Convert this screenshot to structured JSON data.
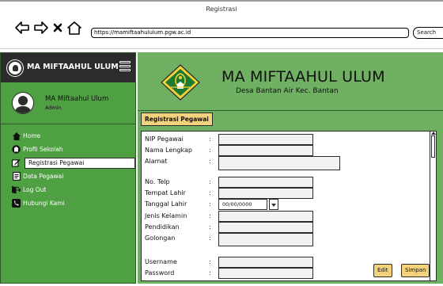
{
  "window": {
    "title": "Registrasi"
  },
  "browser": {
    "url": "https://mamiftaahululum.pgw.ac.id",
    "search_placeholder": "Search"
  },
  "sidebar": {
    "brand": "MA MIFTAAHUL ULUM",
    "user": {
      "name": "MA Miftaahul Ulum",
      "role": "Admin"
    },
    "items": [
      {
        "label": "Home",
        "icon": "home-icon"
      },
      {
        "label": "Profil Sekolah",
        "icon": "school-icon"
      },
      {
        "label": "Registrasi Pegawai",
        "icon": "edit-icon",
        "active": true
      },
      {
        "label": "Data Pegawai",
        "icon": "document-icon"
      },
      {
        "label": "Log Out",
        "icon": "logout-icon"
      },
      {
        "label": "Hubungi Kami",
        "icon": "phone-icon"
      }
    ]
  },
  "header": {
    "school_name": "MA MIFTAAHUL ULUM",
    "address": "Desa Bantan Air Kec. Bantan"
  },
  "form": {
    "tab_label": "Registrasi Pegawai",
    "fields": [
      {
        "label": "NIP Pegawai",
        "value": ""
      },
      {
        "label": "Nama Lengkap",
        "value": ""
      },
      {
        "label": "Alamat",
        "value": ""
      },
      {
        "label": "No. Telp",
        "value": ""
      },
      {
        "label": "Tempat Lahir",
        "value": ""
      },
      {
        "label": "Tanggal Lahir",
        "value": "00/00/0000"
      },
      {
        "label": "Jenis Kelamin",
        "value": ""
      },
      {
        "label": "Pendidikan",
        "value": ""
      },
      {
        "label": "Golongan",
        "value": ""
      },
      {
        "label": "Username",
        "value": ""
      },
      {
        "label": "Password",
        "value": ""
      }
    ],
    "colon": ":",
    "edit_label": "Edit",
    "save_label": "Simpan"
  },
  "colors": {
    "sidebar_bg": "#4f9f43",
    "header_bg": "#6fb062",
    "button_bg": "#f4d27b",
    "dark": "#2c2c2c"
  }
}
